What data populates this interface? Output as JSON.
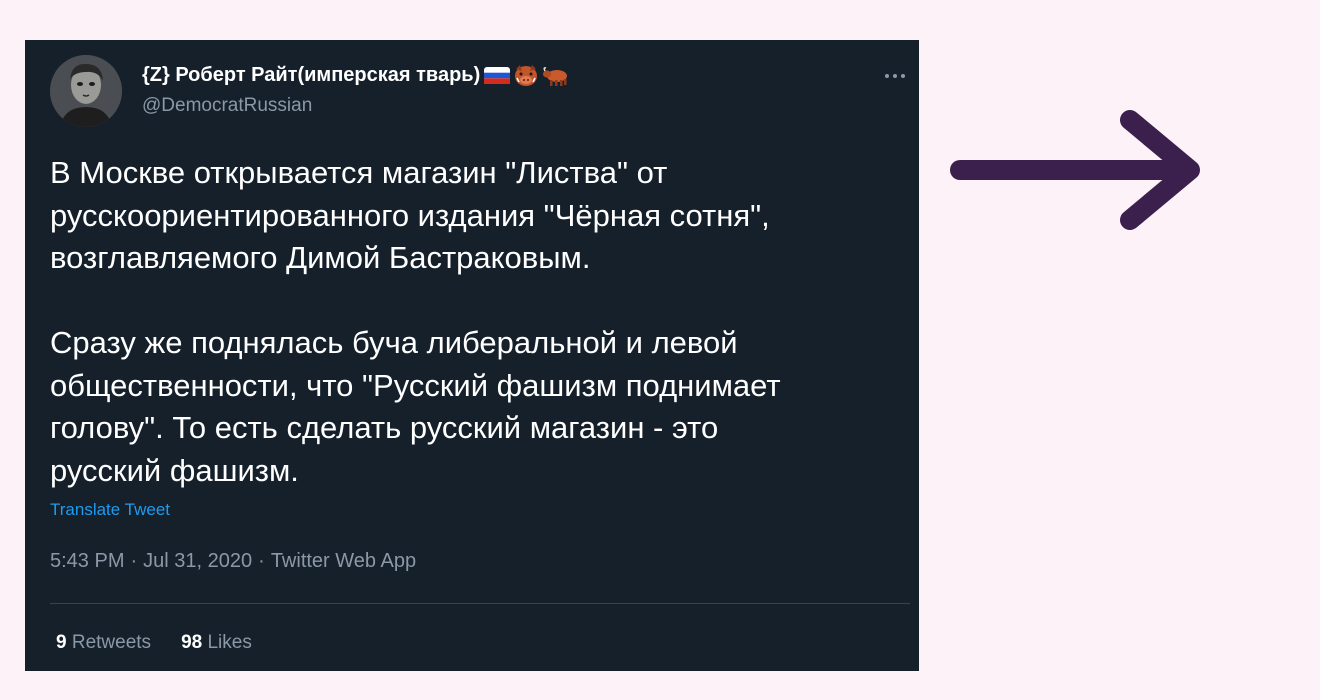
{
  "colors": {
    "background": "#fdf2f8",
    "card": "#15202b",
    "accent": "#1d9bf0",
    "arrow": "#3b1f4d"
  },
  "tweet": {
    "display_name": "{Z} Роберт Райт(имперская тварь)",
    "badge_icons": [
      "russia-flag-icon",
      "boar-icon",
      "ox-icon"
    ],
    "handle": "@DemocratRussian",
    "text": "В Москве открывается магазин \"Листва\" от\nрусскоориентированного издания \"Чёрная сотня\",\nвозглавляемого Димой Бастраковым.\n\nСразу же поднялась буча либеральной и левой\nобщественности, что \"Русский фашизм поднимает\nголову\". То есть сделать русский магазин - это\nрусский фашизм.",
    "translate_label": "Translate Tweet",
    "time": "5:43 PM",
    "separator": "·",
    "date": "Jul 31, 2020",
    "source": "Twitter Web App",
    "retweets_count": "9",
    "retweets_label": "Retweets",
    "likes_count": "98",
    "likes_label": "Likes"
  }
}
